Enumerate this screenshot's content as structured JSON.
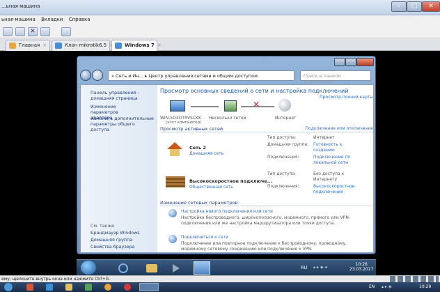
{
  "host": {
    "title": "...ьная машина",
    "menu": [
      "ьная машина",
      "Вкладки",
      "Справка"
    ],
    "tabs": [
      {
        "label": "Главная",
        "active": false
      },
      {
        "label": "Клон mikrotik6.5",
        "active": false
      },
      {
        "label": "Windows 7",
        "active": true
      }
    ],
    "status": "ему, щелкните внутрь окна или нажмите Ctrl+G."
  },
  "window": {
    "address": "« Сеть и Ин... ▸ Центр управления сетями и общим доступом",
    "search_placeholder": "Поиск в панели управления",
    "sidebar": {
      "home": "Панель управления - домашняя страница",
      "adapter": "Изменение параметров адаптера",
      "sharing": "Изменить дополнительные параметры общего доступа",
      "see_also": "См. также",
      "links": [
        "Брандмауэр Windows",
        "Домашняя группа",
        "Свойства браузера"
      ]
    },
    "main": {
      "heading": "Просмотр основных сведений о сети и настройка подключений",
      "full_map": "Просмотр полной карты",
      "map": {
        "computer": "WIN-5O4OTRVSCKK",
        "computer_sub": "(этот компьютер)",
        "networks": "Несколько сетей",
        "internet": "Интернет"
      },
      "active_title": "Просмотр активных сетей",
      "connect_link": "Подключение или отключение",
      "net1": {
        "name": "Сеть 2",
        "type": "Домашняя сеть",
        "access_label": "Тип доступа:",
        "access_value": "Интернет",
        "homegroup_label": "Домашняя группа:",
        "homegroup_value": "Готовность к созданию",
        "connections_label": "Подключения:",
        "connections_value": "Подключение по локальной сети"
      },
      "net2": {
        "name": "Высокоскоростное подключе...",
        "type": "Общественная сеть",
        "access_label": "Тип доступа:",
        "access_value": "Без доступа к Интернету",
        "connections_label": "Подключения:",
        "connections_value": "Высокоскоростное подключение"
      },
      "change_title": "Изменение сетевых параметров",
      "items": [
        {
          "title": "Настройка нового подключения или сети",
          "desc": "Настройка беспроводного, широкополосного, модемного, прямого или VPN-подключения или же настройка маршрутизатора или точки доступа."
        },
        {
          "title": "Подключиться к сети",
          "desc": "Подключение или повторное подключение к беспроводному, проводному, модемному сетевому соединению или подключение к VPN."
        }
      ]
    }
  },
  "vm_taskbar": {
    "lang": "RU",
    "time": "10:26",
    "date": "23.03.2017"
  },
  "host_taskbar": {
    "lang": "EN",
    "time": "10:29"
  },
  "colors": {
    "accent": "#1e5aa8",
    "link": "#2a6cc8",
    "taskbar": "#1f3b5c"
  }
}
